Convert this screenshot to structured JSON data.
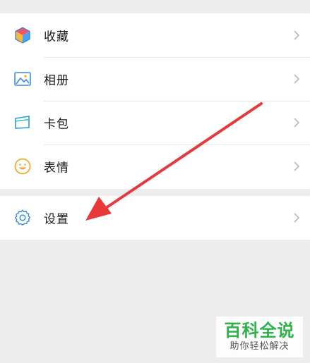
{
  "menu": {
    "items": [
      {
        "label": "收藏",
        "icon": "cube-icon"
      },
      {
        "label": "相册",
        "icon": "image-icon"
      },
      {
        "label": "卡包",
        "icon": "card-icon"
      },
      {
        "label": "表情",
        "icon": "smiley-icon"
      }
    ],
    "settings": {
      "label": "设置",
      "icon": "gear-icon"
    }
  },
  "watermark": {
    "title": "百科全说",
    "subtitle": "助你轻松解决"
  },
  "colors": {
    "background": "#ededed",
    "arrow": "#e8393a",
    "watermark_green": "#2db34a",
    "icon_blue": "#3b8ce6"
  }
}
